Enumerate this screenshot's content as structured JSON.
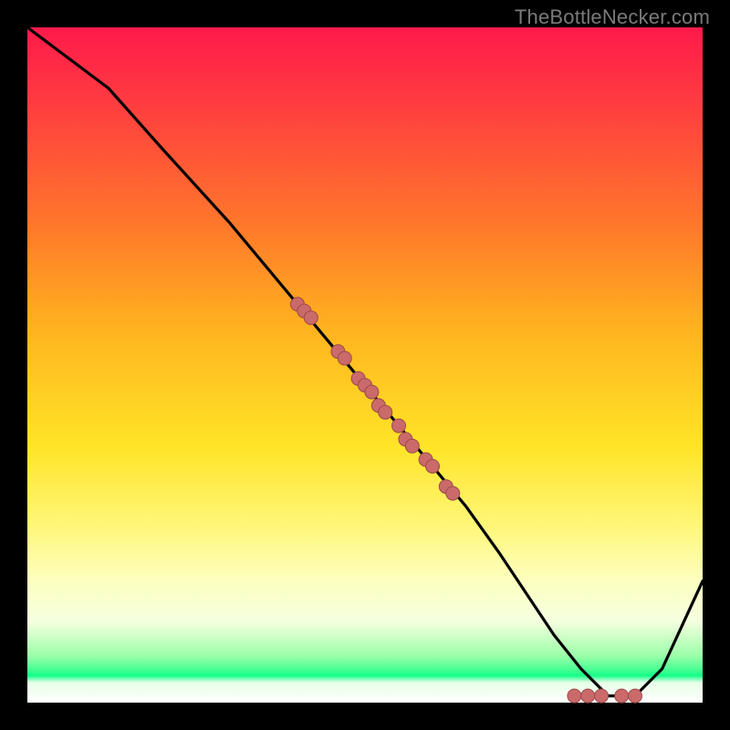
{
  "watermark": "TheBottleNecker.com",
  "colors": {
    "curve": "#000000",
    "dot_fill": "#cb6a6a",
    "dot_stroke": "#9a4a4a"
  },
  "chart_data": {
    "type": "line",
    "title": "",
    "xlabel": "",
    "ylabel": "",
    "xlim": [
      0,
      100
    ],
    "ylim": [
      0,
      100
    ],
    "series": [
      {
        "name": "curve",
        "x": [
          0,
          8,
          12,
          20,
          30,
          40,
          50,
          55,
          60,
          65,
          70,
          74,
          78,
          82,
          86,
          90,
          94,
          100
        ],
        "y": [
          100,
          94,
          91,
          82,
          71,
          59,
          47,
          41,
          35,
          29,
          22,
          16,
          10,
          5,
          1,
          1,
          5,
          18
        ]
      }
    ],
    "markers": {
      "name": "dots-on-curve",
      "points": [
        {
          "x": 40,
          "y": 59
        },
        {
          "x": 41,
          "y": 58
        },
        {
          "x": 42,
          "y": 57
        },
        {
          "x": 46,
          "y": 52
        },
        {
          "x": 47,
          "y": 51
        },
        {
          "x": 49,
          "y": 48
        },
        {
          "x": 50,
          "y": 47
        },
        {
          "x": 51,
          "y": 46
        },
        {
          "x": 52,
          "y": 44
        },
        {
          "x": 53,
          "y": 43
        },
        {
          "x": 55,
          "y": 41
        },
        {
          "x": 56,
          "y": 39
        },
        {
          "x": 57,
          "y": 38
        },
        {
          "x": 59,
          "y": 36
        },
        {
          "x": 60,
          "y": 35
        },
        {
          "x": 62,
          "y": 32
        },
        {
          "x": 63,
          "y": 31
        },
        {
          "x": 81,
          "y": 1
        },
        {
          "x": 83,
          "y": 1
        },
        {
          "x": 85,
          "y": 1
        },
        {
          "x": 88,
          "y": 1
        },
        {
          "x": 90,
          "y": 1
        }
      ]
    }
  }
}
